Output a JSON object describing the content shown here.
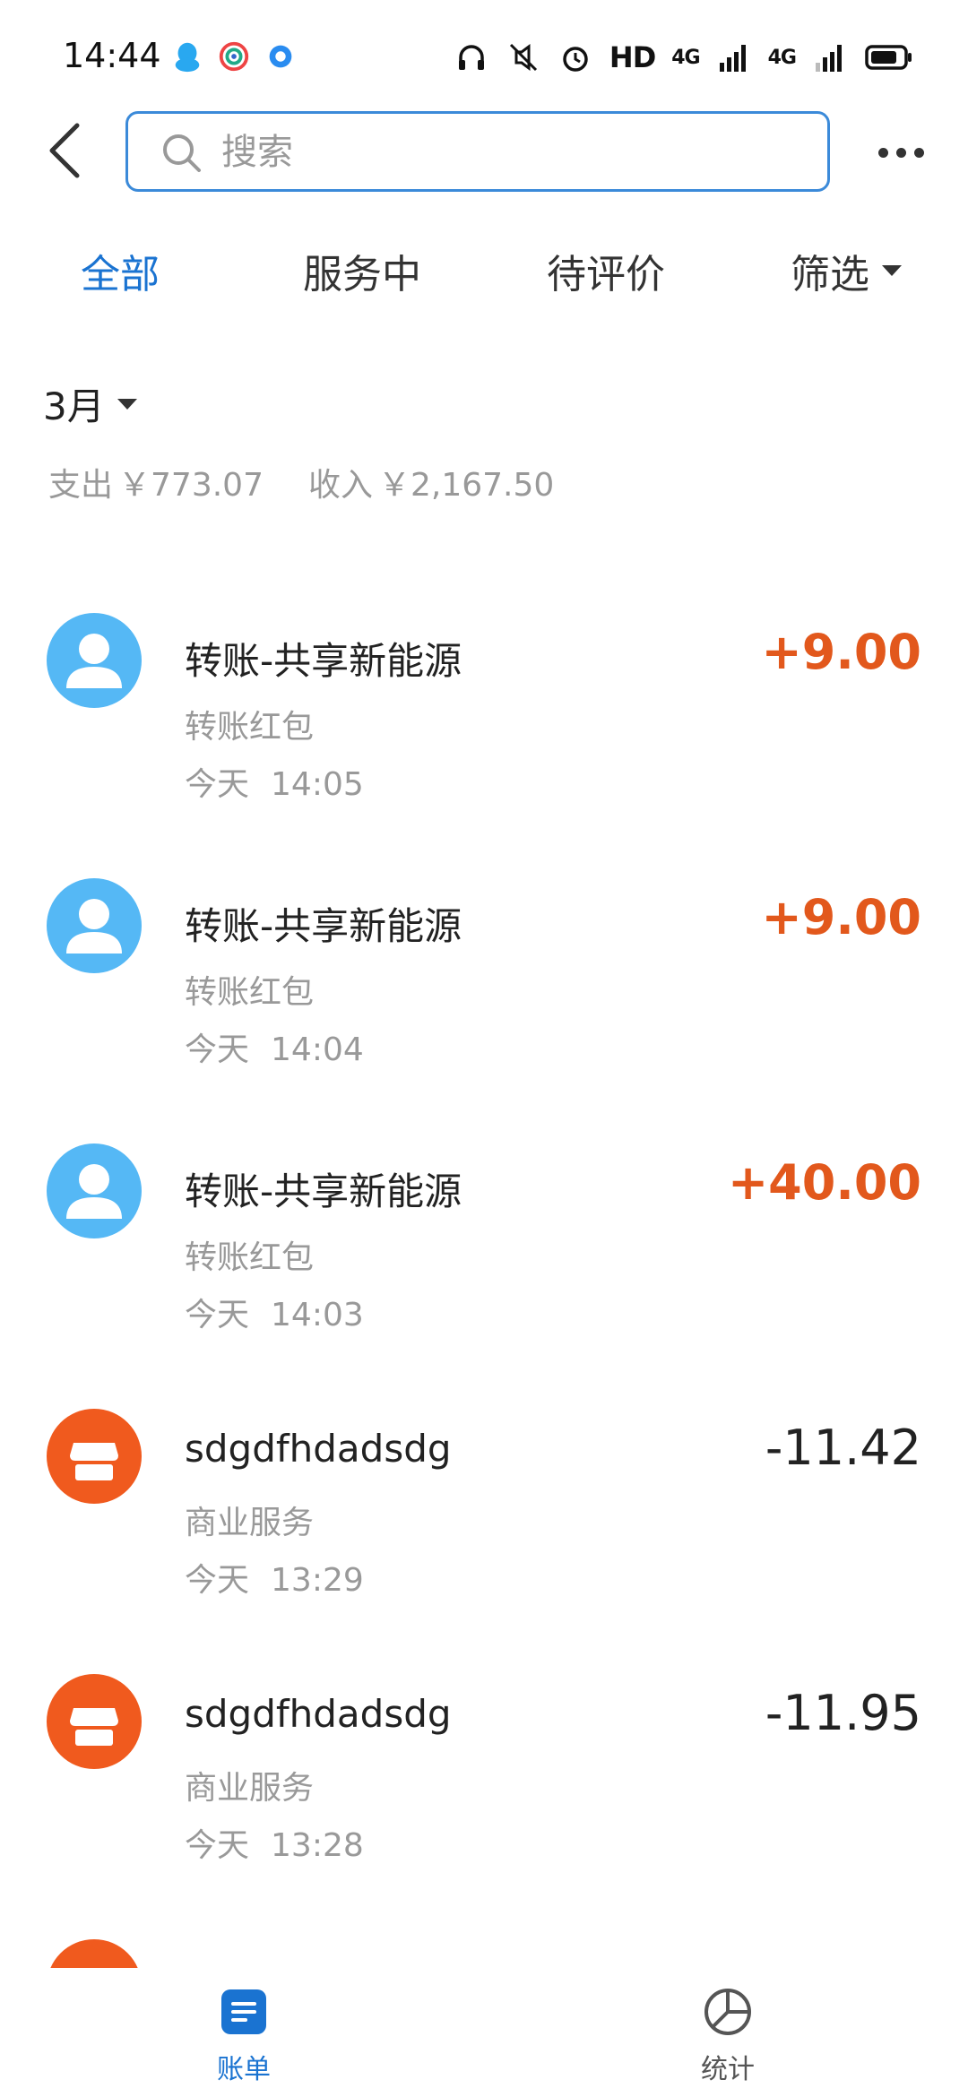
{
  "status_bar": {
    "time": "14:44",
    "hd": "HD",
    "net1": "4G",
    "net2": "4G",
    "left_icons": [
      "qq-icon",
      "app-circle-icon",
      "location-dot-icon"
    ],
    "right_icons": [
      "headphones-icon",
      "mute-icon",
      "alarm-icon",
      "signal-icon",
      "battery-icon"
    ]
  },
  "search": {
    "placeholder": "搜索"
  },
  "tabs": [
    {
      "label": "全部",
      "active": true
    },
    {
      "label": "服务中",
      "active": false
    },
    {
      "label": "待评价",
      "active": false
    },
    {
      "label": "筛选",
      "active": false
    }
  ],
  "month": {
    "label": "3月"
  },
  "summary": {
    "expense_label": "支出",
    "expense_value": "￥773.07",
    "income_label": "收入",
    "income_value": "￥2,167.50"
  },
  "transactions": [
    {
      "title": "转账-共享新能源",
      "category": "转账红包",
      "day": "今天",
      "time": "14:05",
      "amount": "+9.00",
      "type": "income",
      "icon": "person-icon"
    },
    {
      "title": "转账-共享新能源",
      "category": "转账红包",
      "day": "今天",
      "time": "14:04",
      "amount": "+9.00",
      "type": "income",
      "icon": "person-icon"
    },
    {
      "title": "转账-共享新能源",
      "category": "转账红包",
      "day": "今天",
      "time": "14:03",
      "amount": "+40.00",
      "type": "income",
      "icon": "person-icon"
    },
    {
      "title": "sdgdfhdadsdg",
      "category": "商业服务",
      "day": "今天",
      "time": "13:29",
      "amount": "-11.42",
      "type": "expense",
      "icon": "shop-icon"
    },
    {
      "title": "sdgdfhdadsdg",
      "category": "商业服务",
      "day": "今天",
      "time": "13:28",
      "amount": "-11.95",
      "type": "expense",
      "icon": "shop-icon"
    }
  ],
  "bottom_nav": {
    "bill_label": "账单",
    "stats_label": "统计"
  },
  "colors": {
    "accent": "#1a73d1",
    "income": "#e2581c",
    "person_avatar": "#55b8f5",
    "shop_avatar": "#f05a1e"
  }
}
